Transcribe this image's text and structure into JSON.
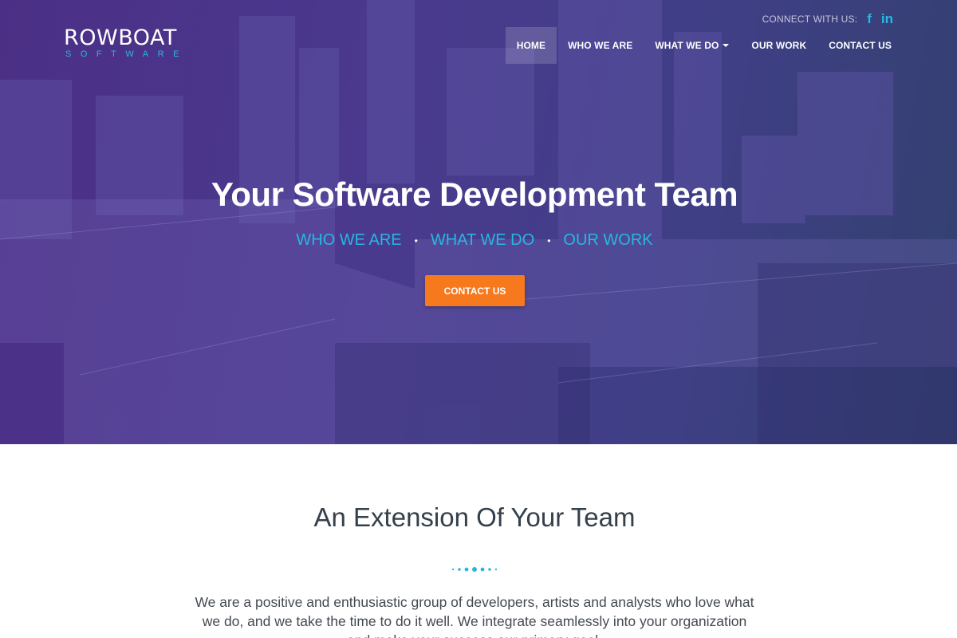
{
  "header": {
    "logo_main": "ROWBOAT",
    "logo_sub": "SOFTWARE",
    "connect_label": "CONNECT WITH US:",
    "social": [
      {
        "name": "facebook",
        "glyph": "f"
      },
      {
        "name": "linkedin",
        "glyph": "in"
      }
    ]
  },
  "nav": {
    "items": [
      {
        "label": "HOME",
        "active": true
      },
      {
        "label": "WHO WE ARE"
      },
      {
        "label": "WHAT WE DO",
        "dropdown": true
      },
      {
        "label": "OUR WORK"
      },
      {
        "label": "CONTACT US"
      }
    ]
  },
  "hero": {
    "title": "Your Software Development Team",
    "links": [
      "WHO WE ARE",
      "WHAT WE DO",
      "OUR WORK"
    ],
    "bullet": "•",
    "cta_label": "CONTACT US"
  },
  "about": {
    "title": "An Extension Of Your Team",
    "body": "We are a positive and enthusiastic group of developers, artists and analysts who love what we do, and we take the time to do it well. We integrate seamlessly into your organization and make your success our primary goal."
  },
  "colors": {
    "accent_blue": "#29b6e3",
    "cta_orange": "#f7791e",
    "hero_purple": "#4b2f86",
    "heading_dark": "#34404b"
  }
}
